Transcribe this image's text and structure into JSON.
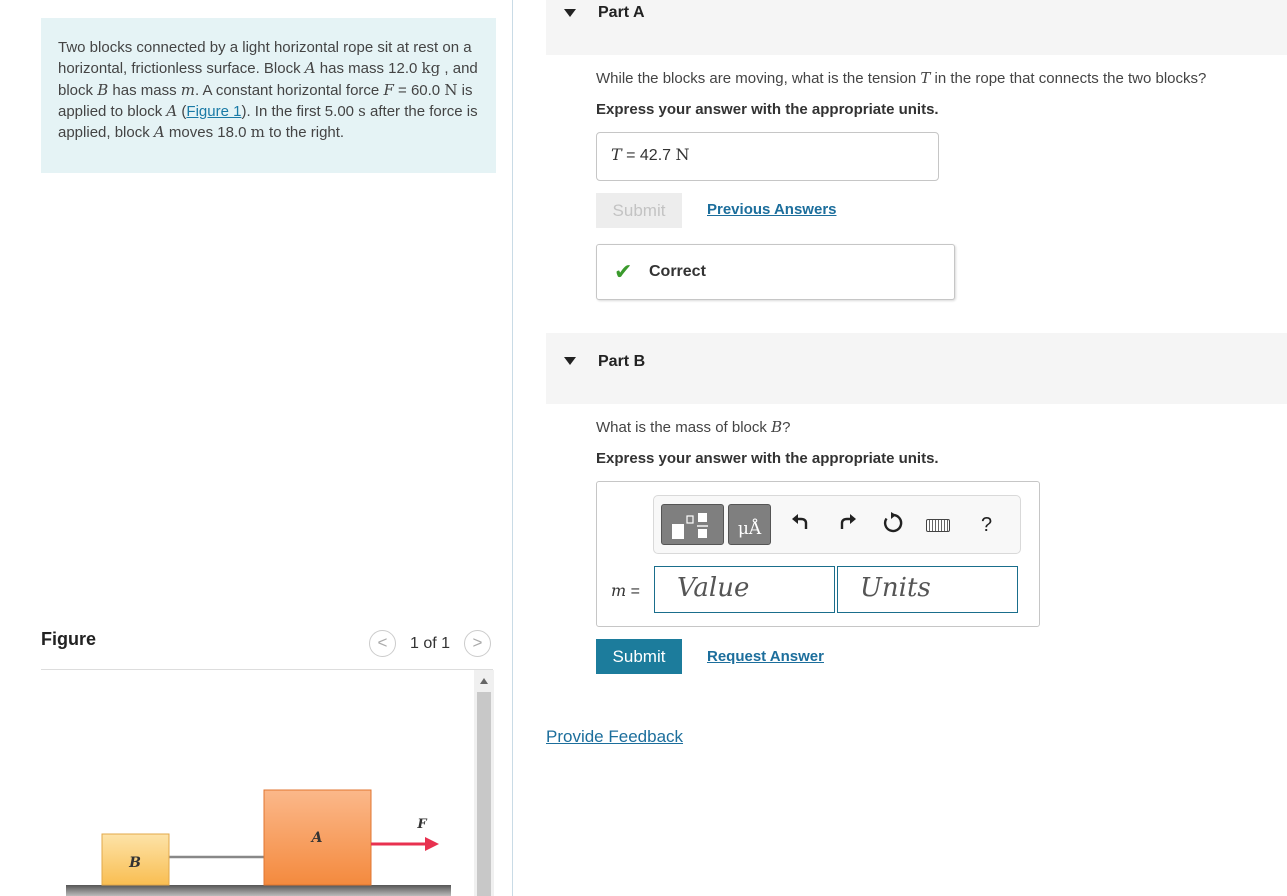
{
  "problem": {
    "text_1": "Two blocks connected by a light horizontal rope sit at rest on a horizontal, frictionless surface. Block ",
    "A": "A",
    "text_2": " has mass 12.0 ",
    "kg": "kg",
    "text_3": " , and block ",
    "B": "B",
    "text_4": " has mass ",
    "m": "m",
    "text_5": ". A constant horizontal force ",
    "F": "F",
    "text_6": " = 60.0 ",
    "N": "N",
    "text_7": " is applied to block ",
    "text_8": " (",
    "figure_link": "Figure 1",
    "text_9": "). In the first 5.00 ",
    "s": "s",
    "text_10": " after the force is applied, block ",
    "text_11": " moves 18.0 ",
    "meter": "m",
    "text_12": " to the right."
  },
  "figure": {
    "label": "Figure",
    "prev": "<",
    "next": ">",
    "count": "1 of 1",
    "block_a_label": "A",
    "block_b_label": "B",
    "force_label": "F",
    "colors": {
      "block_a": "#f79a56",
      "block_b": "#fccf7a",
      "arrow": "#e8314f"
    }
  },
  "partA": {
    "title": "Part A",
    "question_1": "While the blocks are moving, what is the tension ",
    "question_T": "T",
    "question_2": " in the rope that connects the two blocks?",
    "instruction": "Express your answer with the appropriate units.",
    "answer_var": "T",
    "answer_eq": " = ",
    "answer_value": "42.7",
    "answer_unit": "N",
    "submit": "Submit",
    "previous_answers": "Previous Answers",
    "feedback_status": "Correct"
  },
  "partB": {
    "title": "Part B",
    "question_1": "What is the mass of block ",
    "question_B": "B",
    "question_2": "?",
    "instruction": "Express your answer with the appropriate units.",
    "units_button": "μÅ",
    "var_label": "m",
    "var_eq": " =",
    "value_placeholder": "Value",
    "units_placeholder": "Units",
    "help": "?",
    "submit": "Submit",
    "request_answer": "Request Answer"
  },
  "footer": {
    "provide_feedback": "Provide Feedback"
  }
}
